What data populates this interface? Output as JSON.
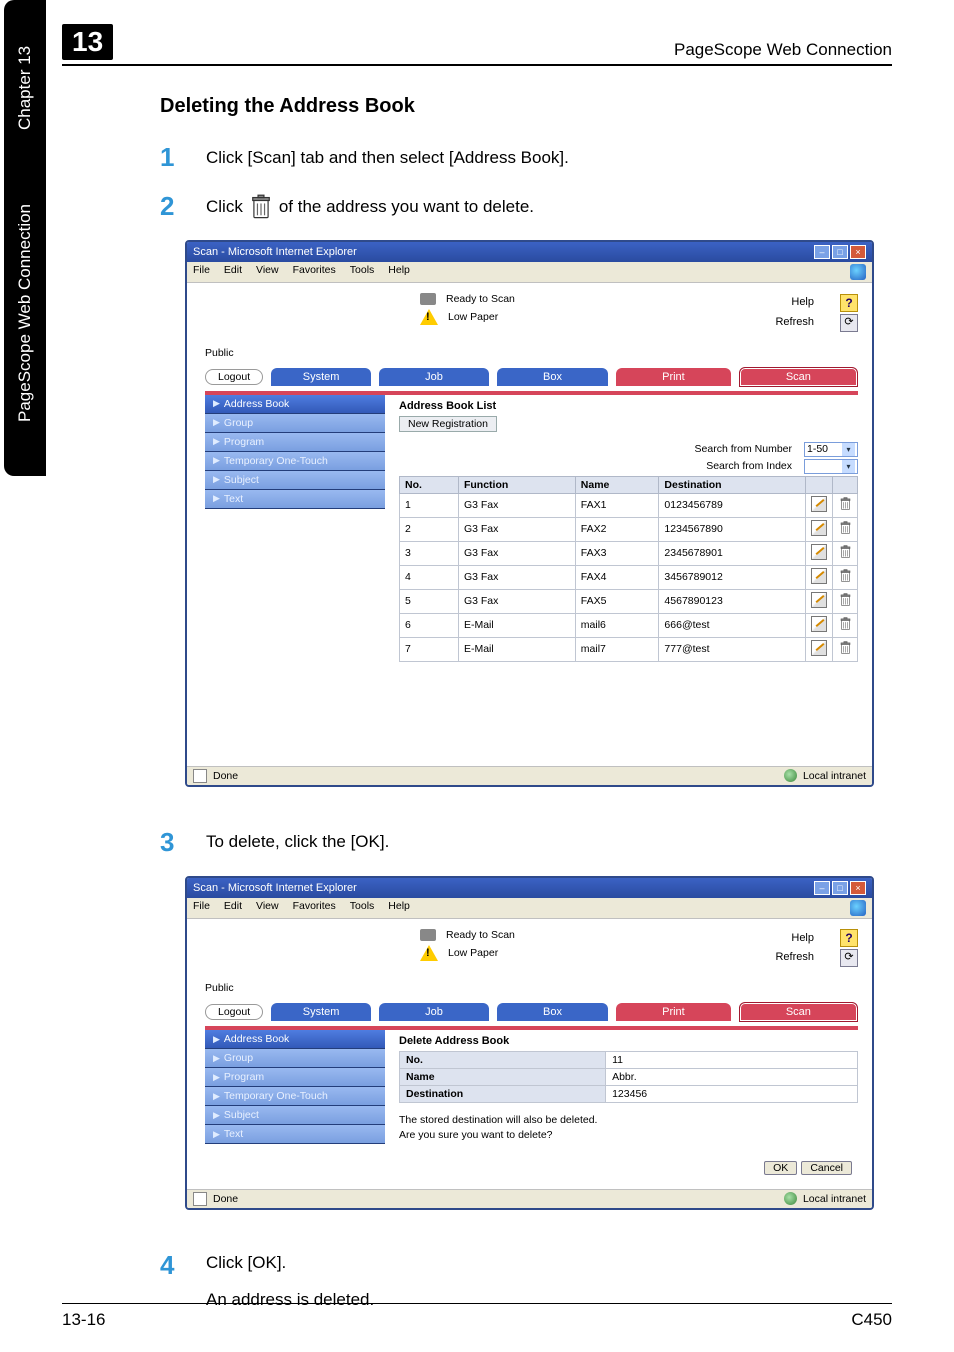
{
  "chapter_num": "13",
  "header_title": "PageScope Web Connection",
  "side_tabs": {
    "chapter": "Chapter 13",
    "product": "PageScope Web Connection"
  },
  "section_heading": "Deleting the Address Book",
  "steps": {
    "s1": {
      "num": "1",
      "text": "Click [Scan] tab and then select [Address Book]."
    },
    "s2": {
      "num": "2",
      "pre": "Click ",
      "post": " of the address you want to delete."
    },
    "s3": {
      "num": "3",
      "text": "To delete, click the [OK]."
    },
    "s4": {
      "num": "4",
      "line1": "Click [OK].",
      "line2": "An address is deleted."
    }
  },
  "browser": {
    "title": "Scan - Microsoft Internet Explorer",
    "menus": [
      "File",
      "Edit",
      "View",
      "Favorites",
      "Tools",
      "Help"
    ],
    "status_ready": "Ready to Scan",
    "status_lowpaper": "Low Paper",
    "help_label": "Help",
    "refresh_label": "Refresh",
    "public": "Public",
    "logout": "Logout",
    "tabs": {
      "system": "System",
      "job": "Job",
      "box": "Box",
      "print": "Print",
      "scan": "Scan"
    },
    "sidemenu": [
      "Address Book",
      "Group",
      "Program",
      "Temporary One-Touch",
      "Subject",
      "Text"
    ],
    "done": "Done",
    "zone": "Local intranet"
  },
  "list_pane": {
    "title": "Address Book List",
    "new_reg": "New Registration",
    "search_number": "Search from Number",
    "search_index": "Search from Index",
    "range": "1-50",
    "headers": {
      "no": "No.",
      "func": "Function",
      "name": "Name",
      "dest": "Destination"
    },
    "rows": [
      {
        "no": "1",
        "func": "G3 Fax",
        "name": "FAX1",
        "dest": "0123456789"
      },
      {
        "no": "2",
        "func": "G3 Fax",
        "name": "FAX2",
        "dest": "1234567890"
      },
      {
        "no": "3",
        "func": "G3 Fax",
        "name": "FAX3",
        "dest": "2345678901"
      },
      {
        "no": "4",
        "func": "G3 Fax",
        "name": "FAX4",
        "dest": "3456789012"
      },
      {
        "no": "5",
        "func": "G3 Fax",
        "name": "FAX5",
        "dest": "4567890123"
      },
      {
        "no": "6",
        "func": "E-Mail",
        "name": "mail6",
        "dest": "666@test"
      },
      {
        "no": "7",
        "func": "E-Mail",
        "name": "mail7",
        "dest": "777@test"
      }
    ]
  },
  "delete_pane": {
    "title": "Delete Address Book",
    "no_label": "No.",
    "name_label": "Name",
    "dest_label": "Destination",
    "no": "11",
    "name": "Abbr.",
    "dest": "123456",
    "msg1": "The stored destination will also be deleted.",
    "msg2": "Are you sure you want to delete?",
    "ok": "OK",
    "cancel": "Cancel"
  },
  "footer": {
    "left": "13-16",
    "right": "C450"
  }
}
